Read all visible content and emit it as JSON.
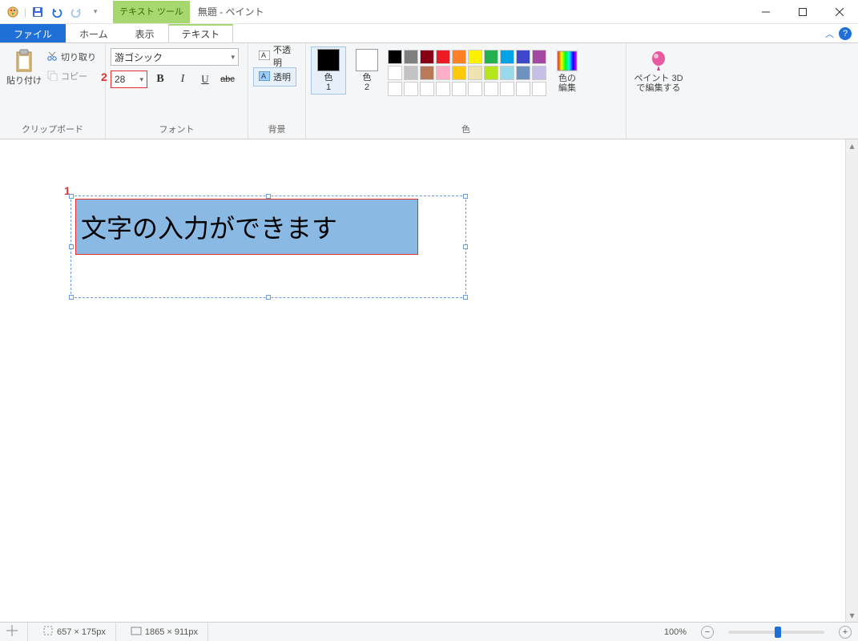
{
  "title": "無題 - ペイント",
  "qat": {
    "tools_label": "テキスト ツール"
  },
  "tabs": {
    "file": "ファイル",
    "home": "ホーム",
    "view": "表示",
    "text": "テキスト"
  },
  "ribbon": {
    "clipboard": {
      "label": "クリップボード",
      "paste": "貼り付け",
      "cut": "切り取り",
      "copy": "コピー"
    },
    "font": {
      "label": "フォント",
      "family": "游ゴシック",
      "size": "28"
    },
    "background": {
      "label": "背景",
      "opaque": "不透明",
      "transparent": "透明"
    },
    "colors": {
      "label": "色",
      "color1": "色\n1",
      "color2": "色\n2",
      "edit": "色の\n編集",
      "row1": [
        "#000000",
        "#7f7f7f",
        "#880015",
        "#ed1c24",
        "#ff7f27",
        "#fff200",
        "#22b14c",
        "#00a2e8",
        "#3f48cc",
        "#a349a4"
      ],
      "row2": [
        "#ffffff",
        "#c3c3c3",
        "#b97a57",
        "#ffaec9",
        "#ffc90e",
        "#efe4b0",
        "#b5e61d",
        "#99d9ea",
        "#7092be",
        "#c8bfe7"
      ]
    },
    "paint3d": "ペイント 3D\nで編集する"
  },
  "canvas": {
    "text_content": "文字の入力ができます",
    "annot1": "1",
    "annot2": "2"
  },
  "status": {
    "selection_size": "657 × 175px",
    "canvas_size": "1865 × 911px",
    "zoom": "100%"
  }
}
